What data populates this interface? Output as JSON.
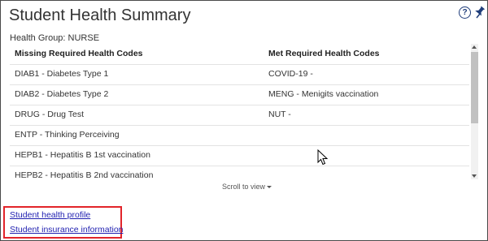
{
  "header": {
    "title": "Student Health Summary",
    "help_icon": "question-circle-icon",
    "pin_icon": "pushpin-icon",
    "help_glyph": "?"
  },
  "health_group": {
    "label": "Health Group: NURSE"
  },
  "table": {
    "columns": [
      "Missing Required Health Codes",
      "Met Required Health Codes"
    ],
    "rows": [
      [
        "DIAB1 - Diabetes Type 1",
        "COVID-19 -"
      ],
      [
        "DIAB2 - Diabetes Type 2",
        "MENG - Menigits vaccination"
      ],
      [
        "DRUG - Drug Test",
        "NUT -"
      ],
      [
        "ENTP - Thinking Perceiving",
        ""
      ],
      [
        "HEPB1 - Hepatitis B 1st vaccination",
        ""
      ],
      [
        "HEPB2 - Hepatitis B 2nd vaccination",
        ""
      ]
    ]
  },
  "scroll_hint": "Scroll to view",
  "links": {
    "health_profile": "Student health profile",
    "insurance_info": "Student insurance information"
  },
  "colors": {
    "link": "#1f1fb0",
    "highlight_box": "#e2242a",
    "icon": "#1f3d7a"
  }
}
